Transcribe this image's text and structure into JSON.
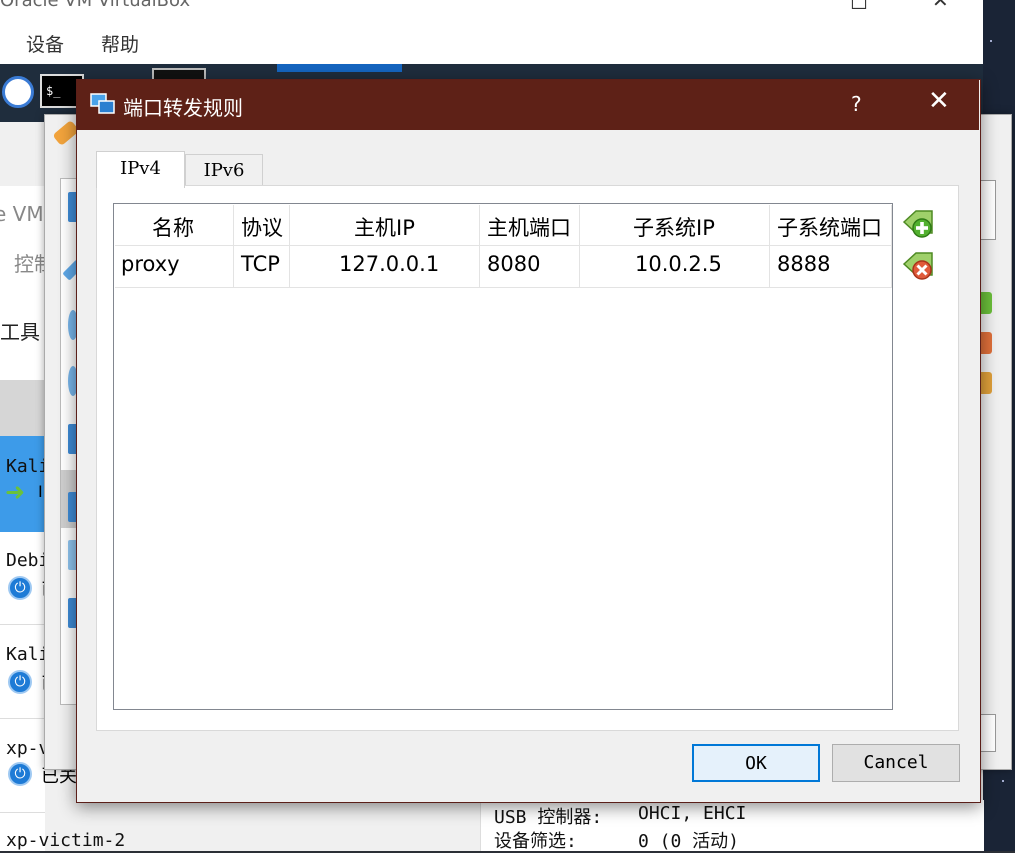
{
  "background_window": {
    "title": "Oracle VM VirtualBox",
    "menu": [
      "设备",
      "帮助"
    ],
    "terminal_glyph": "$_",
    "panel_fragments": [
      "e VM",
      "控制",
      "工具"
    ],
    "vms": [
      {
        "name": "Kali",
        "state_fragment": "I"
      },
      {
        "name": "Debi",
        "state_fragment": "已"
      },
      {
        "name": "Kali",
        "state_fragment": "已"
      },
      {
        "name": "xp-v",
        "state_fragment": "已关"
      },
      {
        "name": "xp-victim-2",
        "state_fragment": ""
      }
    ],
    "details": [
      {
        "label": "USB 控制器:",
        "value": "OHCI, EHCI"
      },
      {
        "label": "设备筛选:",
        "value": "0 (0 活动)"
      }
    ]
  },
  "dialog": {
    "title": "端口转发规则",
    "help_label": "?",
    "close_label": "✕",
    "tabs": [
      {
        "label": "IPv4",
        "active": true
      },
      {
        "label": "IPv6",
        "active": false
      }
    ],
    "table": {
      "columns": [
        "名称",
        "协议",
        "主机IP",
        "主机端口",
        "子系统IP",
        "子系统端口"
      ],
      "rows": [
        {
          "name": "proxy",
          "protocol": "TCP",
          "host_ip": "127.0.0.1",
          "host_port": "8080",
          "guest_ip": "10.0.2.5",
          "guest_port": "8888"
        }
      ]
    },
    "actions": {
      "add_icon": "add-rule-icon",
      "remove_icon": "remove-rule-icon"
    },
    "buttons": {
      "ok": "OK",
      "cancel": "Cancel"
    }
  },
  "colors": {
    "titlebar": "#5e2117",
    "default_button_border": "#0078d7",
    "selected_vm": "#3d9be9"
  }
}
